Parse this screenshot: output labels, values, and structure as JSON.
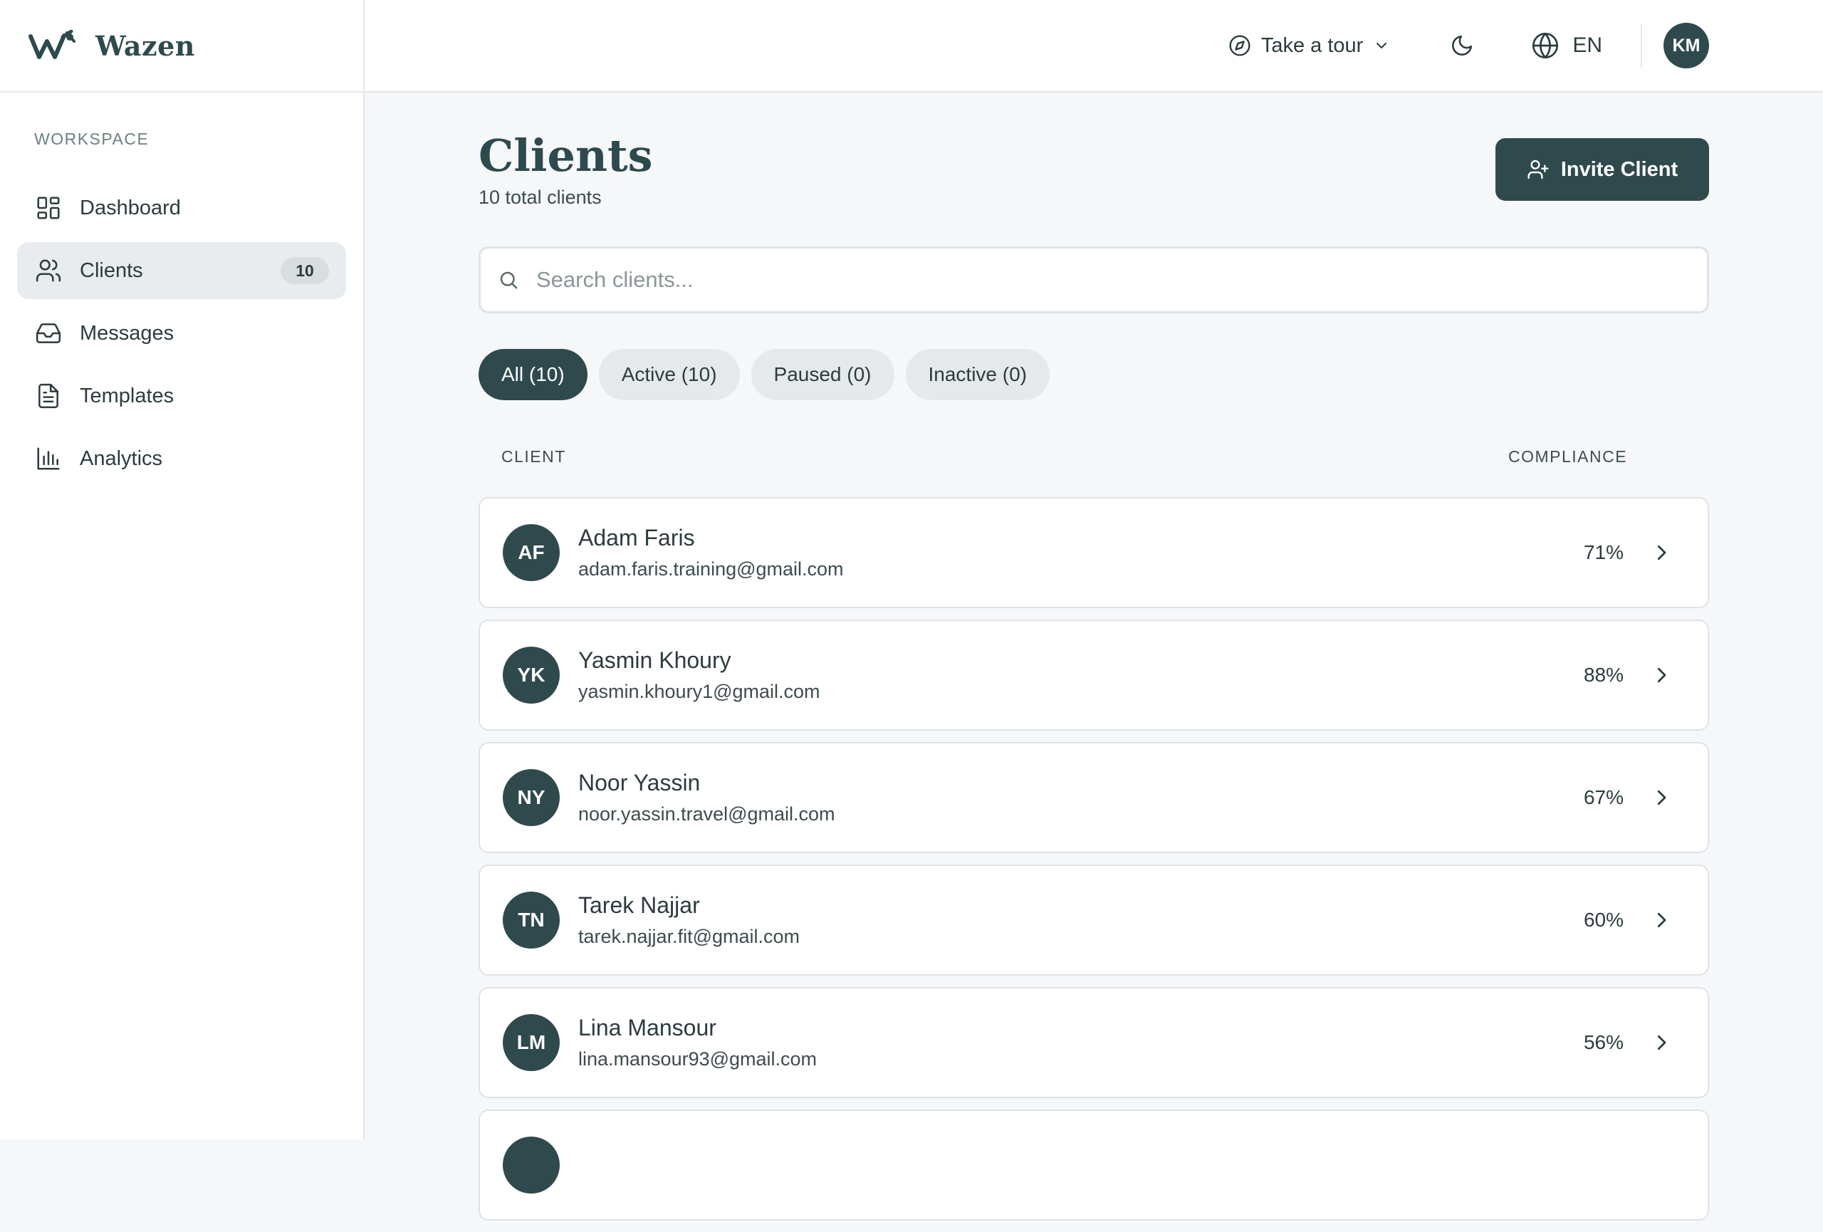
{
  "brand": {
    "name": "Wazen"
  },
  "topbar": {
    "tour_label": "Take a tour",
    "language": "EN",
    "user_initials": "KM"
  },
  "sidebar": {
    "heading": "WORKSPACE",
    "items": [
      {
        "label": "Dashboard",
        "icon": "dashboard-icon"
      },
      {
        "label": "Clients",
        "icon": "users-icon",
        "badge": "10",
        "active": true
      },
      {
        "label": "Messages",
        "icon": "inbox-icon"
      },
      {
        "label": "Templates",
        "icon": "file-text-icon"
      },
      {
        "label": "Analytics",
        "icon": "bar-chart-icon"
      }
    ]
  },
  "main": {
    "title": "Clients",
    "subtitle": "10 total clients",
    "invite_label": "Invite Client",
    "search_placeholder": "Search clients...",
    "filters": [
      {
        "label": "All (10)",
        "active": true
      },
      {
        "label": "Active (10)"
      },
      {
        "label": "Paused (0)"
      },
      {
        "label": "Inactive (0)"
      }
    ],
    "columns": {
      "client": "CLIENT",
      "compliance": "COMPLIANCE"
    },
    "clients": [
      {
        "initials": "AF",
        "name": "Adam Faris",
        "email": "adam.faris.training@gmail.com",
        "compliance": "71%"
      },
      {
        "initials": "YK",
        "name": "Yasmin Khoury",
        "email": "yasmin.khoury1@gmail.com",
        "compliance": "88%"
      },
      {
        "initials": "NY",
        "name": "Noor Yassin",
        "email": "noor.yassin.travel@gmail.com",
        "compliance": "67%"
      },
      {
        "initials": "TN",
        "name": "Tarek Najjar",
        "email": "tarek.najjar.fit@gmail.com",
        "compliance": "60%"
      },
      {
        "initials": "LM",
        "name": "Lina Mansour",
        "email": "lina.mansour93@gmail.com",
        "compliance": "56%"
      },
      {
        "initials": "",
        "name": "",
        "email": "",
        "compliance": ""
      }
    ]
  },
  "colors": {
    "primary": "#2f4a4d",
    "background": "#f5f7f9",
    "chip": "#e6e9eb"
  }
}
